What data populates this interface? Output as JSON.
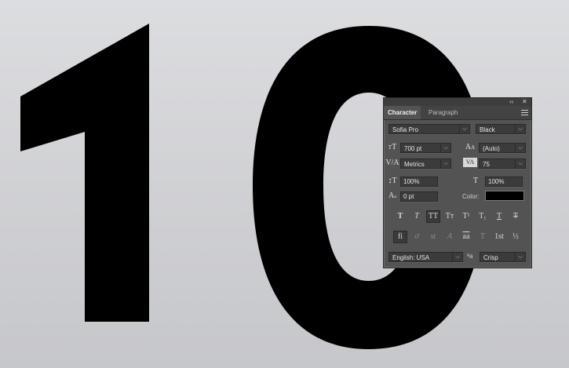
{
  "canvas": {
    "text": "10",
    "color": "#000000"
  },
  "panel": {
    "tabs": [
      "Character",
      "Paragraph"
    ],
    "active_tab": "Character",
    "font_family": "Sofia Pro",
    "font_style": "Black",
    "font_size": "700 pt",
    "leading": "(Auto)",
    "kerning": "Metrics",
    "tracking": "75",
    "vertical_scale": "100%",
    "horizontal_scale": "100%",
    "baseline_shift": "0 pt",
    "color_label": "Color:",
    "text_color": "#000000",
    "style_buttons": [
      "T",
      "T",
      "TT",
      "Tт",
      "T¹",
      "T₁",
      "T",
      "T"
    ],
    "opentype_buttons": [
      "fi",
      "ơ",
      "st",
      "A",
      "aa",
      "T",
      "1st",
      "½"
    ],
    "language": "English: USA",
    "aa_icon": "ªa",
    "antialias": "Crisp",
    "titlebar_collapse": "‹‹",
    "titlebar_close": "✕"
  },
  "icons": {
    "font_size": "font-size-icon",
    "leading": "leading-icon",
    "kerning": "kerning-icon",
    "tracking": "tracking-icon",
    "vertical_scale": "vertical-scale-icon",
    "horizontal_scale": "horizontal-scale-icon",
    "baseline": "baseline-shift-icon"
  }
}
